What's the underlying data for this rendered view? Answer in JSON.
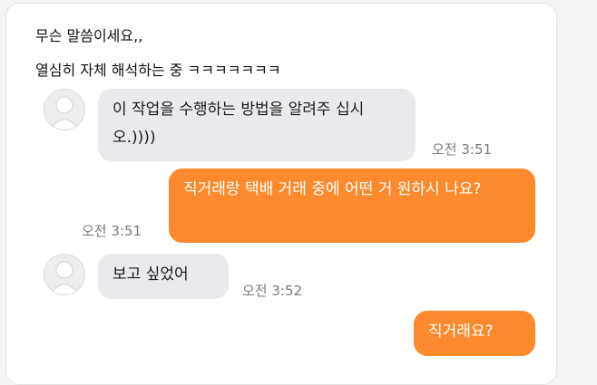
{
  "post": {
    "caption_line1": "무슨 말씀이세요,,",
    "caption_line2": "열심히 자체 해석하는 중 ㅋㅋㅋㅋㅋㅋㅋ"
  },
  "chat": {
    "messages": [
      {
        "side": "incoming",
        "text": "이 작업을 수행하는 방법을 알려주 십시오.))))",
        "time": "오전 3:51"
      },
      {
        "side": "outgoing",
        "text": "직거래랑 택배 거래 중에 어떤 거 원하시 나요?",
        "time": "오전 3:51"
      },
      {
        "side": "incoming",
        "text": "보고 싶었어",
        "time": "오전 3:52"
      },
      {
        "side": "outgoing",
        "text": "직거래요?",
        "time": ""
      }
    ]
  },
  "colors": {
    "outgoing_bubble": "#fe8a2e",
    "incoming_bubble": "#e9eaee",
    "timestamp": "#7a7a7a"
  },
  "icons": {
    "avatar": "default-profile-icon"
  }
}
